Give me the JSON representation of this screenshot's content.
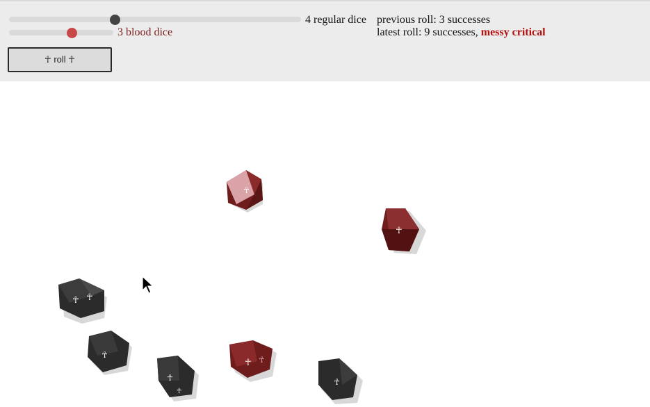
{
  "controls": {
    "regular_dice": {
      "label": "4 regular dice",
      "value": 4
    },
    "blood_dice": {
      "label": "3 blood dice",
      "value": 3
    },
    "roll_button_label": "☥ roll ☥"
  },
  "results": {
    "previous_roll": "previous roll: 3 successes",
    "latest_roll_prefix": "latest roll: 9 successes,",
    "latest_roll_critical": "messy critical"
  },
  "colors": {
    "regular_die": "#2b2b2b",
    "blood_die": "#6e1c1c",
    "blood_die_light": "#d9a3a8",
    "critical_text": "#b01010"
  },
  "dice": [
    {
      "type": "blood",
      "symbol": "ankh"
    },
    {
      "type": "blood",
      "symbol": "ankh"
    },
    {
      "type": "regular",
      "symbol": "ankh"
    },
    {
      "type": "regular",
      "symbol": "ankh"
    },
    {
      "type": "regular",
      "symbol": "ankh"
    },
    {
      "type": "blood",
      "symbol": "ankh"
    },
    {
      "type": "regular",
      "symbol": "ankh"
    }
  ]
}
